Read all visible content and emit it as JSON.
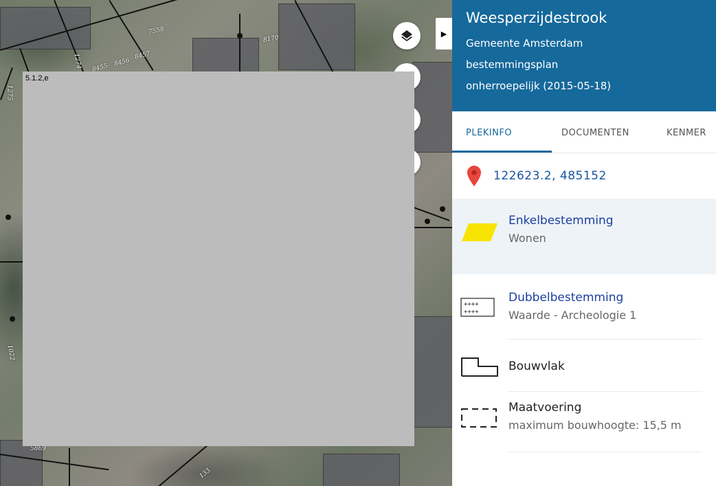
{
  "map": {
    "parcel_numbers": [
      "7558",
      "8170",
      "8457",
      "8456",
      "8455",
      "1275",
      "1022",
      "5869",
      "133",
      "1274"
    ],
    "redaction_label": "5.1.2,e"
  },
  "panel": {
    "title": "Weesperzijdestrook",
    "subtitle_lines": [
      "Gemeente Amsterdam",
      "bestemmingsplan",
      "onherroepelijk (2015-05-18)"
    ],
    "tabs": [
      {
        "label": "PLEKINFO",
        "active": true
      },
      {
        "label": "DOCUMENTEN",
        "active": false
      },
      {
        "label": "KENMER",
        "active": false
      }
    ],
    "coordinates": "122623.2, 485152",
    "items": [
      {
        "icon": "yellow-parallelogram-icon",
        "title": "Enkelbestemming",
        "subtitle": "Wonen"
      },
      {
        "icon": "dotted-grid-icon",
        "title": "Dubbelbestemming",
        "subtitle": "Waarde - Archeologie 1"
      },
      {
        "icon": "building-outline-icon",
        "label": "Bouwvlak"
      },
      {
        "icon": "dashed-box-icon",
        "title": "Maatvoering",
        "subtitle": "maximum bouwhoogte: 15,5 m"
      }
    ]
  },
  "colors": {
    "header_bg": "#16699b",
    "accent_blue": "#1d3f9e",
    "marker_red": "#e8453c",
    "zone_yellow": "#f7e400",
    "redaction_gray": "#bcbcbc"
  }
}
